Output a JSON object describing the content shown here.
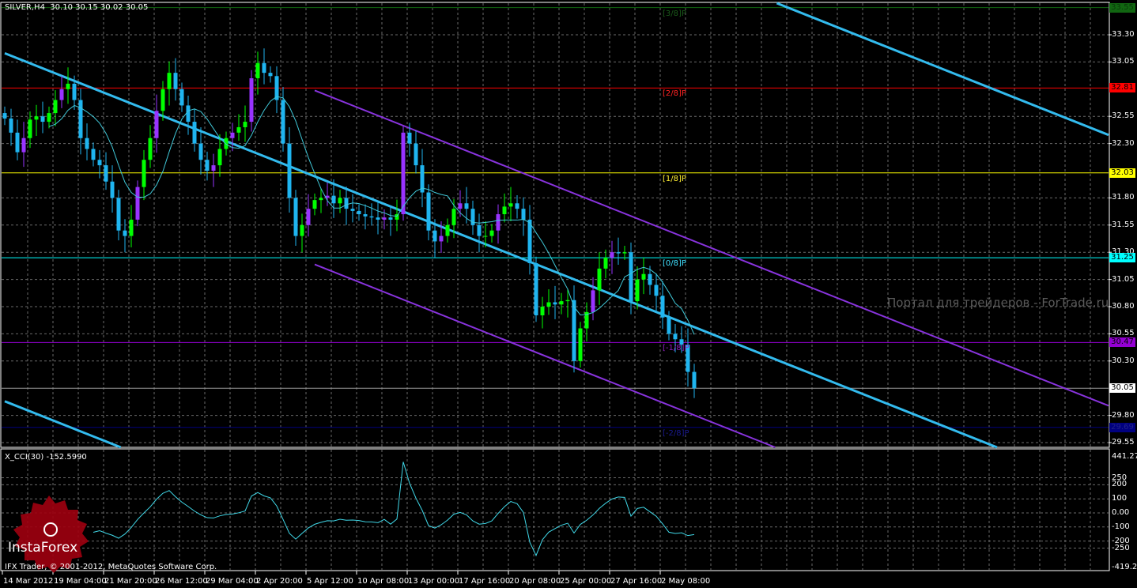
{
  "header": {
    "symbol": "SILVER,H4",
    "ohlc": "30.10 30.15 30.02 30.05"
  },
  "indicator": {
    "title": "X_CCI(30) -152.5990",
    "axis_max": "441.274",
    "axis_min": "-419.246",
    "ticks": [
      "250",
      "200",
      "100",
      "0.00",
      "-100",
      "-200",
      "-250"
    ]
  },
  "copyright": "IFX Trader, © 2001-2012, MetaQuotes Software Corp.",
  "watermark": "Портал для трейдеров - ForTrade.ru",
  "logo": "InstaForex",
  "colors": {
    "bull": "#00ff00",
    "bull_alt": "#9933ff",
    "bear": "#1fb5f0",
    "regression": "#33bbee",
    "channel": "#8833dd",
    "ma": "#40c8d8",
    "cci": "#40d8e8",
    "grid": "#6a6a6a"
  },
  "time_labels": [
    "14 Mar 2012",
    "19 Mar 04:00",
    "21 Mar 20:00",
    "26 Mar 12:00",
    "29 Mar 04:00",
    "2 Apr 20:00",
    "5 Apr 12:00",
    "10 Apr 08:00",
    "13 Apr 00:00",
    "17 Apr 16:00",
    "20 Apr 08:00",
    "25 Apr 00:00",
    "27 Apr 16:00",
    "2 May 08:00"
  ],
  "price_ticks": [
    "33.30",
    "33.05",
    "32.55",
    "32.30",
    "31.80",
    "31.55",
    "31.30",
    "31.05",
    "30.80",
    "30.55",
    "30.30",
    "29.80",
    "29.55"
  ],
  "murrey_levels": [
    {
      "label": "[3/8]P",
      "price": 33.55,
      "box": "33.55",
      "color": "#116611",
      "text": "#1a5a1a"
    },
    {
      "label": "[2/8]P",
      "price": 32.81,
      "box": "32.81",
      "color": "#ff0000",
      "text": "#ff2222"
    },
    {
      "label": "[1/8]P",
      "price": 32.03,
      "box": "32.03",
      "color": "#ffff00",
      "text": "#ffee33"
    },
    {
      "label": "[0/8]P",
      "price": 31.25,
      "box": "31.25",
      "color": "#00ffff",
      "text": "#40e0ff"
    },
    {
      "label": "[-1/8]P",
      "price": 30.47,
      "box": "30.47",
      "color": "#9400d3",
      "text": "#9020c0"
    },
    {
      "label": "[-2/8]P",
      "price": 29.69,
      "box": "29.69",
      "color": "#000080",
      "text": "#1a1a90"
    }
  ],
  "current_price": {
    "price": 30.05,
    "box": "30.05"
  },
  "chart_data": {
    "type": "candlestick",
    "ylim": [
      29.5,
      33.62
    ],
    "closes": [
      32.53,
      32.4,
      32.22,
      32.35,
      32.52,
      32.55,
      32.5,
      32.58,
      32.7,
      32.8,
      32.85,
      32.7,
      32.35,
      32.25,
      32.15,
      32.1,
      31.95,
      31.8,
      31.5,
      31.45,
      31.6,
      31.9,
      32.15,
      32.35,
      32.6,
      32.8,
      32.95,
      32.8,
      32.65,
      32.5,
      32.3,
      32.15,
      32.05,
      32.1,
      32.25,
      32.35,
      32.4,
      32.45,
      32.5,
      32.9,
      33.04,
      32.95,
      32.92,
      32.7,
      32.3,
      31.8,
      31.45,
      31.55,
      31.7,
      31.78,
      31.8,
      31.82,
      31.75,
      31.8,
      31.7,
      31.68,
      31.65,
      31.63,
      31.62,
      31.6,
      31.62,
      31.6,
      31.65,
      32.4,
      32.3,
      32.1,
      31.85,
      31.5,
      31.4,
      31.45,
      31.55,
      31.7,
      31.75,
      31.7,
      31.55,
      31.45,
      31.45,
      31.5,
      31.65,
      31.72,
      31.75,
      31.7,
      31.6,
      31.2,
      30.72,
      30.8,
      30.84,
      30.82,
      30.85,
      30.86,
      30.3,
      30.6,
      30.75,
      30.95,
      31.15,
      31.25,
      31.3,
      31.29,
      31.3,
      30.85,
      31.05,
      31.1,
      31.0,
      30.9,
      30.7,
      30.55,
      30.5,
      30.45,
      30.2,
      30.05
    ],
    "regression": {
      "start_price": 33.13,
      "slope_per_bar": -0.0231
    },
    "regression_offsets": [
      -3.28,
      0,
      3.2
    ],
    "channel_offsets": [
      -0.79,
      0.81
    ],
    "channel_start_bar": 49,
    "ma_period": 8,
    "cci_period": 15
  }
}
